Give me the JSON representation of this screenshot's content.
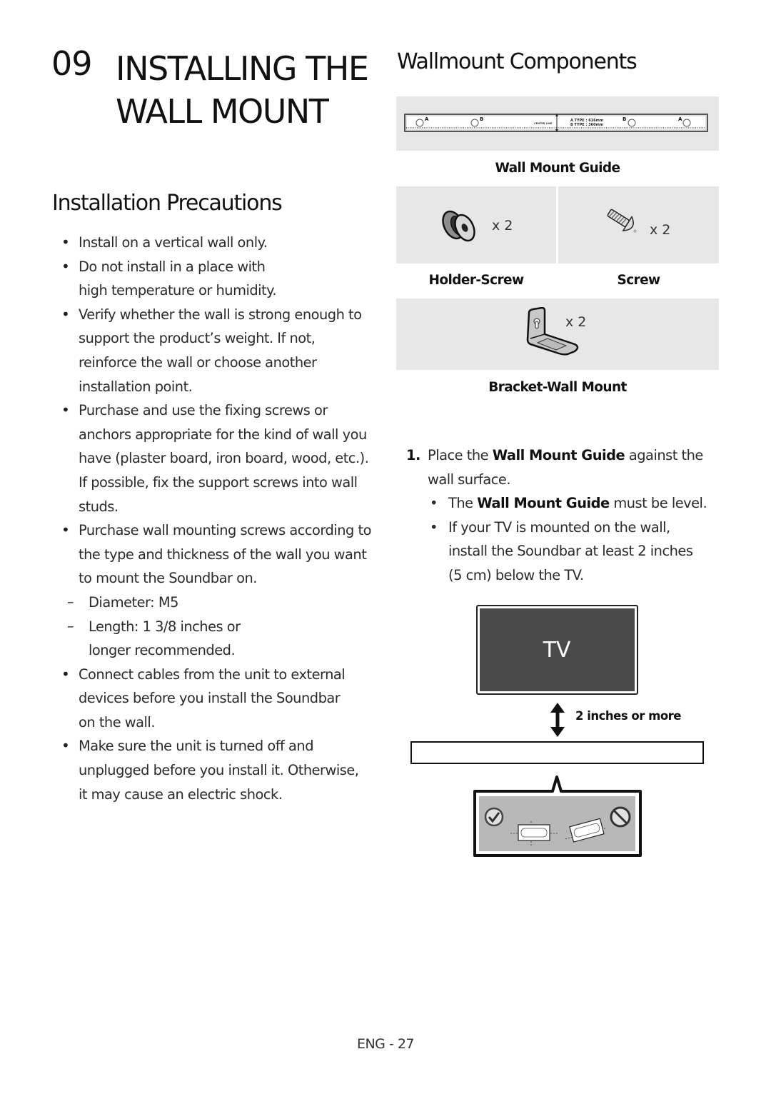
{
  "chapter": {
    "number": "09",
    "title_lines": [
      "INSTALLING THE",
      "WALL MOUNT"
    ]
  },
  "precautions": {
    "heading": "Installation Precautions",
    "items": [
      "Install on a vertical wall only.",
      "Do not install in a place with high temperature or humidity.",
      "Verify whether the wall is strong enough to support the product’s weight. If not, reinforce the wall or choose another installation point.",
      "Purchase and use the fixing screws or anchors appropriate for the kind of wall you have (plaster board, iron board, wood, etc.). If possible, fix the support screws into wall studs.",
      "Purchase wall mounting screws according to the type and thickness of the wall you want to mount the Soundbar on.",
      "Connect cables from the unit to external devices before you install the Soundbar on the wall.",
      "Make sure the unit is turned off and unplugged before you install it. Otherwise, it may cause an electric shock."
    ],
    "screw_specs": [
      "Diameter: M5",
      "Length: 1 3/8 inches or longer recommended."
    ]
  },
  "components": {
    "heading": "Wallmount Components",
    "guide": {
      "label": "Wall Mount Guide",
      "marks": {
        "a": "A",
        "b": "B",
        "center": "CENTER LINE"
      },
      "type_a": "A TYPE : 616mm",
      "type_b": "B TYPE : 360mm"
    },
    "holder_screw": {
      "label": "Holder-Screw",
      "qty": "x 2"
    },
    "screw": {
      "label": "Screw",
      "qty": "x 2"
    },
    "bracket": {
      "label": "Bracket-Wall Mount",
      "qty": "x 2"
    }
  },
  "step1": {
    "number": "1.",
    "text_pre": "Place the ",
    "text_bold": "Wall Mount Guide",
    "text_post": " against the wall surface.",
    "bullets": [
      {
        "pre": "The ",
        "bold": "Wall Mount Guide",
        "post": " must be level."
      },
      {
        "pre": "If your TV is mounted on the wall, install the Soundbar at least 2 inches (5 cm) below the TV.",
        "bold": "",
        "post": ""
      }
    ]
  },
  "diagram": {
    "tv_label": "TV",
    "gap_label": "2 inches or more",
    "level_ok_icon": "check-circle-icon",
    "level_bad_icon": "prohibited-icon"
  },
  "footer": {
    "page": "ENG - 27"
  }
}
